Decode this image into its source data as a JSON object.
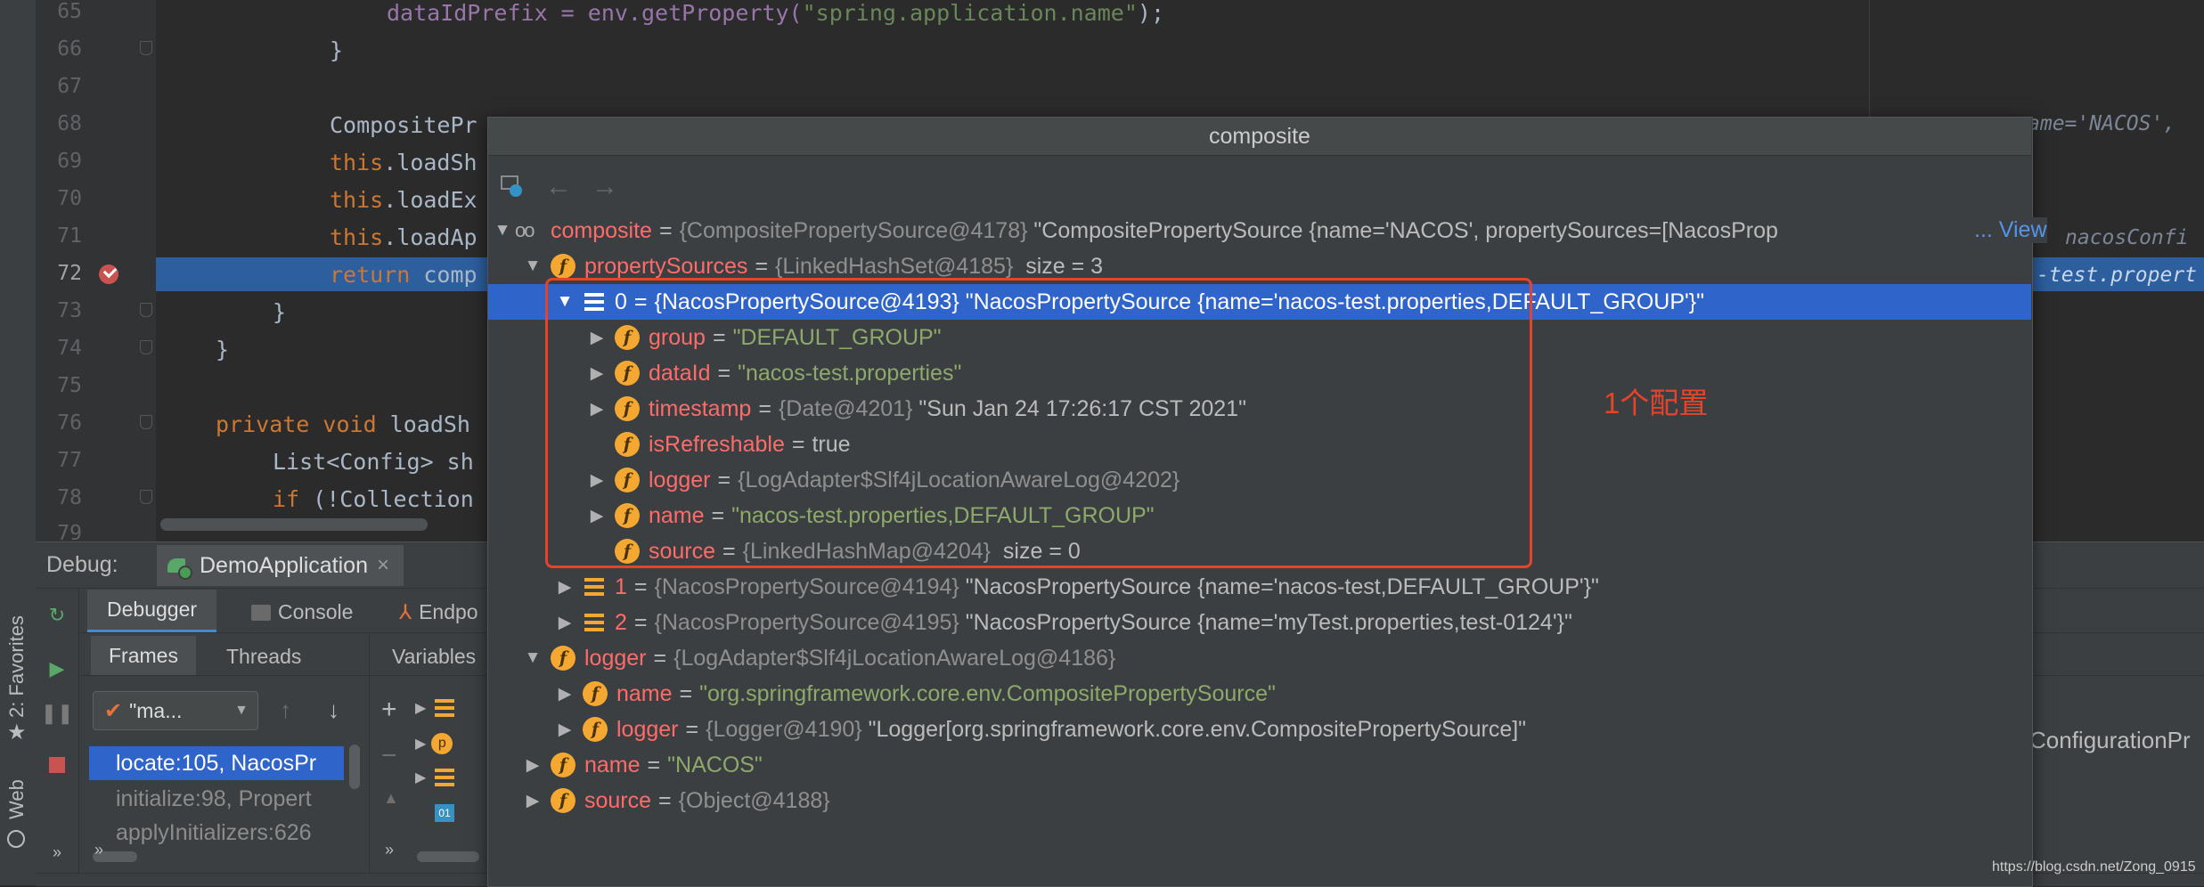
{
  "editor": {
    "line_numbers": [
      "65",
      "66",
      "67",
      "68",
      "69",
      "70",
      "71",
      "72",
      "73",
      "74",
      "75",
      "76",
      "77",
      "78",
      "79"
    ],
    "current_line": "72",
    "lines": {
      "l65": {
        "a": "dataIdPrefix = env.getProperty(",
        "s": "\"spring.application.name\"",
        "b": ");"
      },
      "l66": "}",
      "l68": "CompositePr",
      "l69": {
        "kw": "this",
        "rest": ".loadSh"
      },
      "l70": {
        "kw": "this",
        "rest": ".loadEx"
      },
      "l71": {
        "kw": "this",
        "rest": ".loadAp"
      },
      "l72": {
        "kw": "return",
        "rest": " comp"
      },
      "l73": "}",
      "l74": "}",
      "l76": {
        "kw": "private void",
        "rest": " loadSh"
      },
      "l77": "List<Config> sh",
      "l78": {
        "kw": "if",
        "rest": " (!Collection"
      }
    },
    "ghost_right": {
      "r68": "ame='NACOS',",
      "r71": "nacosConfi",
      "r72": "-test.propert"
    }
  },
  "popup": {
    "title": "composite",
    "view_link": "... View",
    "rows": [
      {
        "name": "composite",
        "type": "{CompositePropertySource@4178}",
        "value": "\"CompositePropertySource {name='NACOS', propertySources=[NacosProp"
      },
      {
        "name": "propertySources",
        "type": "{LinkedHashSet@4185}",
        "value": "size = 3"
      },
      {
        "name": "0",
        "type": "{NacosPropertySource@4193}",
        "value": "\"NacosPropertySource {name='nacos-test.properties,DEFAULT_GROUP'}\""
      },
      {
        "name": "group",
        "value": "\"DEFAULT_GROUP\""
      },
      {
        "name": "dataId",
        "value": "\"nacos-test.properties\""
      },
      {
        "name": "timestamp",
        "type": "{Date@4201}",
        "value": "\"Sun Jan 24 17:26:17 CST 2021\""
      },
      {
        "name": "isRefreshable",
        "value": "true"
      },
      {
        "name": "logger",
        "type": "{LogAdapter$Slf4jLocationAwareLog@4202}"
      },
      {
        "name": "name",
        "value": "\"nacos-test.properties,DEFAULT_GROUP\""
      },
      {
        "name": "source",
        "type": "{LinkedHashMap@4204}",
        "value": "size = 0"
      },
      {
        "name": "1",
        "type": "{NacosPropertySource@4194}",
        "value": "\"NacosPropertySource {name='nacos-test,DEFAULT_GROUP'}\""
      },
      {
        "name": "2",
        "type": "{NacosPropertySource@4195}",
        "value": "\"NacosPropertySource {name='myTest.properties,test-0124'}\""
      },
      {
        "name": "logger",
        "type": "{LogAdapter$Slf4jLocationAwareLog@4186}"
      },
      {
        "name": "name",
        "value": "\"org.springframework.core.env.CompositePropertySource\""
      },
      {
        "name": "logger",
        "type": "{Logger@4190}",
        "value": "\"Logger[org.springframework.core.env.CompositePropertySource]\""
      },
      {
        "name": "name",
        "value": "\"NACOS\""
      },
      {
        "name": "source",
        "type": "{Object@4188}"
      }
    ]
  },
  "annotation": {
    "text": "1个配置",
    "color": "#e5442b"
  },
  "debug": {
    "label": "Debug:",
    "session_tab": "DemoApplication",
    "close": "×",
    "subtabs": {
      "debugger": "Debugger",
      "console": "Console",
      "endpoints": "Endpo"
    },
    "frames_tab": "Frames",
    "threads_tab": "Threads",
    "variables_tab": "Variables",
    "thread_combo": "\"ma...",
    "frames": [
      "locate:105, NacosPr",
      "initialize:98, Propert",
      "applyInitializers:626"
    ],
    "right_text": "ConfigurationPr"
  },
  "side": {
    "favorites": "2: Favorites",
    "web": "Web"
  },
  "watermark": "https://blog.csdn.net/Zong_0915",
  "colors": {
    "selection": "#2f65ca",
    "exec_line": "#2d5e9e",
    "string": "#6a8759",
    "keyword": "#cc7832",
    "field_name": "#ff6b68",
    "annotation": "#e5442b"
  }
}
